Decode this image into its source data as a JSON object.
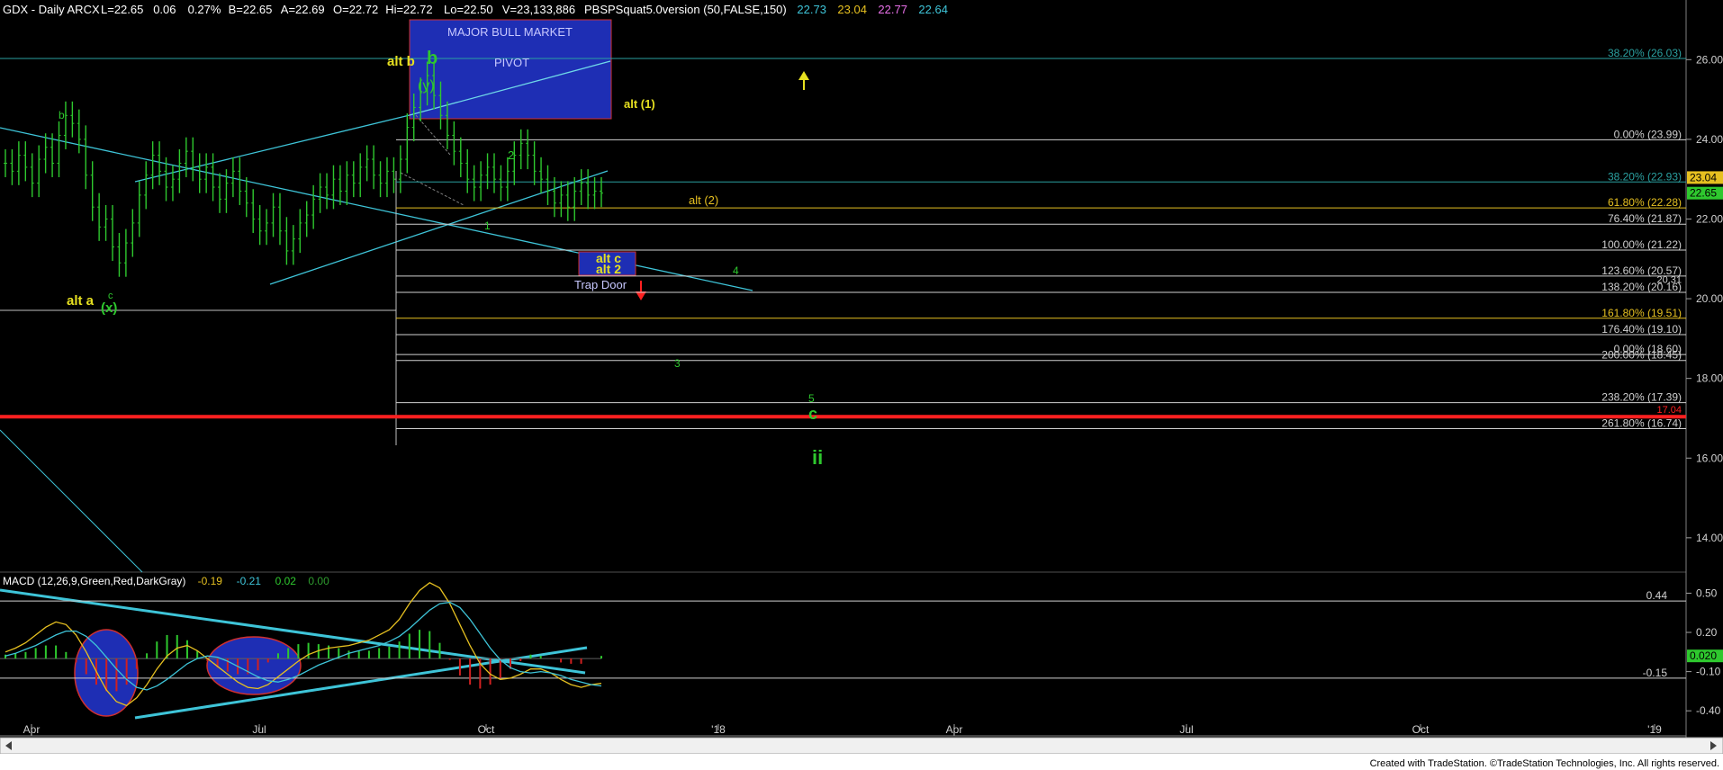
{
  "header": {
    "symbol": "GDX - Daily  ARCX",
    "quote": [
      {
        "label": "L=22.65",
        "color": "#ffffff"
      },
      {
        "label": "0.06",
        "color": "#ffffff"
      },
      {
        "label": "0.27%",
        "color": "#ffffff"
      },
      {
        "label": "B=22.65",
        "color": "#ffffff"
      },
      {
        "label": "A=22.69",
        "color": "#ffffff"
      },
      {
        "label": "O=22.72",
        "color": "#ffffff"
      },
      {
        "label": "Hi=22.72",
        "color": "#ffffff"
      },
      {
        "label": "Lo=22.50",
        "color": "#ffffff"
      },
      {
        "label": "V=23,133,886",
        "color": "#ffffff"
      },
      {
        "label": "PBSPSquat5.0version (50,FALSE,150)",
        "color": "#ffffff"
      },
      {
        "label": "22.73",
        "color": "#3ec4d8"
      },
      {
        "label": "23.04",
        "color": "#e6c020"
      },
      {
        "label": "22.77",
        "color": "#e870e8"
      },
      {
        "label": "22.64",
        "color": "#3ec4d8"
      }
    ]
  },
  "macd_header": [
    {
      "label": "MACD (12,26,9,Green,Red,DarkGray)",
      "color": "#ffffff"
    },
    {
      "label": "-0.19",
      "color": "#e6c020"
    },
    {
      "label": "-0.21",
      "color": "#3ec4d8"
    },
    {
      "label": "0.02",
      "color": "#2ec82e"
    },
    {
      "label": "0.00",
      "color": "#2e9c2e"
    }
  ],
  "footer": {
    "credit": "Created with TradeStation. ©TradeStation Technologies, Inc. All rights reserved."
  },
  "chart_data": {
    "type": "bar",
    "title": "GDX - Daily",
    "price_axis": {
      "ylim": [
        13.5,
        27.0
      ],
      "ticks": [
        "26.00",
        "24.00",
        "22.00",
        "20.00",
        "18.00",
        "16.00",
        "14.00"
      ],
      "tick_values": [
        26,
        24,
        22,
        20,
        18,
        16,
        14
      ]
    },
    "macd_axis": {
      "ylim": [
        -0.55,
        0.62
      ],
      "ticks": [
        "0.50",
        "0.20",
        "-0.10",
        "-0.40"
      ],
      "tick_values": [
        0.5,
        0.2,
        -0.1,
        -0.4
      ]
    },
    "x_ticks": [
      "Apr",
      "Jul",
      "Oct",
      "'18",
      "Apr",
      "Jul",
      "Oct",
      "'19"
    ],
    "last_price_labels": [
      {
        "label": "23.04",
        "value": 23.04,
        "bg": "#e6c020",
        "fg": "#000000"
      },
      {
        "label": "22.65",
        "value": 22.65,
        "bg": "#2ec82e",
        "fg": "#000000"
      }
    ],
    "macd_last_label": {
      "label": "0.020",
      "value": 0.02,
      "bg": "#2ec82e",
      "fg": "#000000"
    },
    "fib_levels": [
      {
        "label": "38.20% (26.03)",
        "value": 26.03,
        "color": "#2aa0a0"
      },
      {
        "label": "0.00% (23.99)",
        "value": 23.99,
        "color": "#d0d0d0"
      },
      {
        "label": "38.20% (22.93)",
        "value": 22.93,
        "color": "#2aa0a0"
      },
      {
        "label": "61.80% (22.28)",
        "value": 22.28,
        "color": "#e6c020"
      },
      {
        "label": "76.40% (21.87)",
        "value": 21.87,
        "color": "#d0d0d0"
      },
      {
        "label": "100.00% (21.22)",
        "value": 21.22,
        "color": "#d0d0d0"
      },
      {
        "label": "123.60% (20.57)",
        "value": 20.57,
        "color": "#d0d0d0"
      },
      {
        "label": "138.20% (20.16)",
        "value": 20.16,
        "color": "#d0d0d0"
      },
      {
        "label": "161.80% (19.51)",
        "value": 19.51,
        "color": "#e6c020"
      },
      {
        "label": "176.40% (19.10)",
        "value": 19.1,
        "color": "#d0d0d0"
      },
      {
        "label": "0.00% (18.60)",
        "value": 18.6,
        "color": "#d0d0d0"
      },
      {
        "label": "200.00% (18.45)",
        "value": 18.45,
        "color": "#d0d0d0"
      },
      {
        "label": "238.20% (17.39)",
        "value": 17.39,
        "color": "#d0d0d0"
      },
      {
        "label": "261.80% (16.74)",
        "value": 16.74,
        "color": "#d0d0d0"
      }
    ],
    "extra_levels": [
      {
        "label": "20.31",
        "value": 20.31,
        "color": "#d0d0d0"
      },
      {
        "label": "17.04",
        "value": 17.04,
        "color": "#ff2020"
      }
    ],
    "macd_levels": [
      {
        "label": "0.44",
        "value": 0.44
      },
      {
        "label": "-0.15",
        "value": -0.15
      }
    ],
    "annotations": [
      {
        "text": "MAJOR BULL MARKET",
        "color": "#c8c8ff",
        "kind": "box-text"
      },
      {
        "text": "PIVOT",
        "color": "#c8c8ff",
        "kind": "box-text"
      },
      {
        "text": "alt b",
        "color": "#e6e020",
        "kind": "wave"
      },
      {
        "text": "b",
        "color": "#2ec82e",
        "kind": "wave-big"
      },
      {
        "text": "(y)",
        "color": "#2ec82e",
        "kind": "wave"
      },
      {
        "text": "alt (1)",
        "color": "#e6e020",
        "kind": "wave-small"
      },
      {
        "text": "b",
        "color": "#2ec82e",
        "kind": "wave-small"
      },
      {
        "text": "c",
        "color": "#2ec82e",
        "kind": "wave-small"
      },
      {
        "text": "alt a",
        "color": "#e6e020",
        "kind": "wave"
      },
      {
        "text": "(x)",
        "color": "#2ec82e",
        "kind": "wave"
      },
      {
        "text": "2",
        "color": "#2ec82e",
        "kind": "wave-small"
      },
      {
        "text": "1",
        "color": "#2ec82e",
        "kind": "wave-small"
      },
      {
        "text": "alt (2)",
        "color": "#e6c020",
        "kind": "wave-small"
      },
      {
        "text": "alt c",
        "color": "#e6e020",
        "kind": "wave"
      },
      {
        "text": "alt 2",
        "color": "#e6e020",
        "kind": "wave"
      },
      {
        "text": "Trap Door",
        "color": "#c8c8ff",
        "kind": "note"
      },
      {
        "text": "4",
        "color": "#2ec82e",
        "kind": "wave-small"
      },
      {
        "text": "3",
        "color": "#2ec82e",
        "kind": "wave-small"
      },
      {
        "text": "5",
        "color": "#2ec82e",
        "kind": "wave-small"
      },
      {
        "text": "c",
        "color": "#2ec82e",
        "kind": "wave-big"
      },
      {
        "text": "ii",
        "color": "#2ec82e",
        "kind": "wave-big"
      }
    ],
    "series": [
      {
        "name": "GDX",
        "color": "#2ec82e",
        "values": [
          23.4,
          23.2,
          23.6,
          23.3,
          22.9,
          23.5,
          23.8,
          23.4,
          24.1,
          24.6,
          24.4,
          24.0,
          23.1,
          22.3,
          21.8,
          22.0,
          21.3,
          20.9,
          21.4,
          21.9,
          22.6,
          23.1,
          23.6,
          23.2,
          22.8,
          23.0,
          23.4,
          23.7,
          23.3,
          23.0,
          23.3,
          22.8,
          22.5,
          22.9,
          23.2,
          22.7,
          22.4,
          22.0,
          21.7,
          21.9,
          22.3,
          21.7,
          21.2,
          21.5,
          21.9,
          22.1,
          22.5,
          22.8,
          22.6,
          23.0,
          22.7,
          23.1,
          22.9,
          23.3,
          23.5,
          23.1,
          22.9,
          23.2,
          23.0,
          23.5,
          24.3,
          24.8,
          25.2,
          25.6,
          25.1,
          24.6,
          24.1,
          23.7,
          23.4,
          23.0,
          22.8,
          23.1,
          23.3,
          23.0,
          22.8,
          23.2,
          23.6,
          23.9,
          23.6,
          23.2,
          23.0,
          22.7,
          22.4,
          22.6,
          22.3,
          22.7,
          22.9,
          22.6,
          22.7,
          22.65
        ]
      },
      {
        "name": "MACD",
        "color": "#e6c020",
        "values": [
          0.05,
          0.08,
          0.12,
          0.18,
          0.24,
          0.28,
          0.26,
          0.18,
          0.05,
          -0.1,
          -0.24,
          -0.33,
          -0.36,
          -0.3,
          -0.2,
          -0.08,
          0.02,
          0.08,
          0.1,
          0.06,
          0.0,
          -0.06,
          -0.12,
          -0.18,
          -0.22,
          -0.23,
          -0.2,
          -0.14,
          -0.08,
          -0.02,
          0.03,
          0.06,
          0.08,
          0.09,
          0.1,
          0.12,
          0.14,
          0.18,
          0.22,
          0.3,
          0.42,
          0.52,
          0.58,
          0.54,
          0.42,
          0.26,
          0.1,
          -0.04,
          -0.12,
          -0.16,
          -0.15,
          -0.12,
          -0.08,
          -0.08,
          -0.11,
          -0.16,
          -0.2,
          -0.22,
          -0.2,
          -0.19
        ]
      },
      {
        "name": "MACDAvg",
        "color": "#3ec4d8",
        "values": [
          0.02,
          0.04,
          0.07,
          0.1,
          0.14,
          0.18,
          0.21,
          0.21,
          0.17,
          0.1,
          0.01,
          -0.08,
          -0.16,
          -0.22,
          -0.24,
          -0.21,
          -0.16,
          -0.1,
          -0.04,
          0.0,
          0.02,
          0.01,
          -0.02,
          -0.06,
          -0.1,
          -0.14,
          -0.17,
          -0.18,
          -0.16,
          -0.13,
          -0.09,
          -0.05,
          -0.02,
          0.01,
          0.04,
          0.06,
          0.08,
          0.1,
          0.13,
          0.17,
          0.23,
          0.3,
          0.37,
          0.42,
          0.43,
          0.39,
          0.3,
          0.19,
          0.08,
          -0.01,
          -0.07,
          -0.1,
          -0.11,
          -0.1,
          -0.11,
          -0.13,
          -0.16,
          -0.18,
          -0.2,
          -0.21
        ]
      }
    ]
  }
}
